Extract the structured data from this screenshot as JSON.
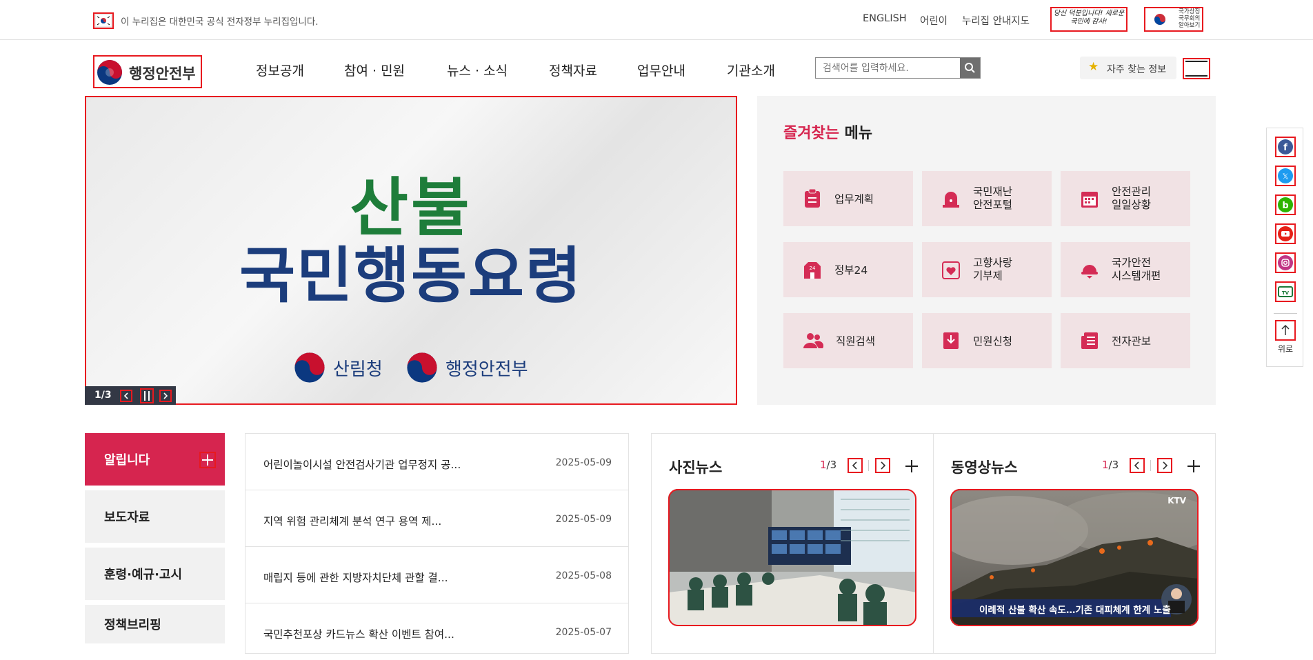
{
  "topbar": {
    "gov_notice": "이 누리집은 대한민국 공식 전자정부 누리집입니다.",
    "links": [
      "ENGLISH",
      "어린이",
      "누리집 안내지도"
    ],
    "banner1_text": "당신 덕분입니다! 새로운 국민에 감사!",
    "banner2_text": "국가상징 국무회의 알아보기"
  },
  "header": {
    "logo_text": "행정안전부",
    "nav": [
      "정보공개",
      "참여 · 민원",
      "뉴스 · 소식",
      "정책자료",
      "업무안내",
      "기관소개"
    ],
    "search_placeholder": "검색어를 입력하세요.",
    "fav_label": "자주 찾는 정보"
  },
  "hero": {
    "line1": "산불",
    "line2": "국민행동요령",
    "org1": "산림청",
    "org2": "행정안전부",
    "counter": "1/3"
  },
  "favorites": {
    "title_accent": "즐겨찾는",
    "title_rest": " 메뉴",
    "items": [
      {
        "label": "업무계획",
        "icon": "clipboard-icon"
      },
      {
        "label": "국민재난\n안전포털",
        "icon": "siren-icon"
      },
      {
        "label": "안전관리\n일일상황",
        "icon": "calendar-icon"
      },
      {
        "label": "정부24",
        "icon": "building-24-icon"
      },
      {
        "label": "고향사랑\n기부제",
        "icon": "heart-icon"
      },
      {
        "label": "국가안전\n시스템개편",
        "icon": "helmet-icon"
      },
      {
        "label": "직원검색",
        "icon": "people-icon"
      },
      {
        "label": "민원신청",
        "icon": "inbox-download-icon"
      },
      {
        "label": "전자관보",
        "icon": "document-list-icon"
      }
    ]
  },
  "quick": {
    "items": [
      "facebook-icon",
      "x-twitter-icon",
      "blog-icon",
      "youtube-icon",
      "instagram-icon",
      "tv-icon"
    ],
    "top_label": "위로"
  },
  "board": {
    "tabs": [
      "알립니다",
      "보도자료",
      "훈령·예규·고시",
      "정책브리핑"
    ],
    "rows": [
      {
        "title": "어린이놀이시설 안전검사기관 업무정지 공...",
        "date": "2025-05-09"
      },
      {
        "title": "지역 위험 관리체계 분석 연구 용역 제...",
        "date": "2025-05-09"
      },
      {
        "title": "매립지 등에 관한 지방자치단체 관할 결...",
        "date": "2025-05-08"
      },
      {
        "title": "국민추천포상 카드뉴스 확산 이벤트 참여...",
        "date": "2025-05-07"
      }
    ]
  },
  "media": {
    "photo": {
      "title": "사진뉴스",
      "current": "1",
      "total": "/3"
    },
    "video": {
      "title": "동영상뉴스",
      "current": "1",
      "total": "/3",
      "badge": "KTV",
      "caption": "이례적 산불 확산 속도…기존 대피체계 한계 노출"
    }
  }
}
